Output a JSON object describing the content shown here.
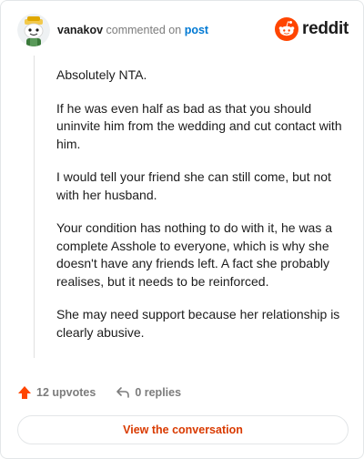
{
  "header": {
    "username": "vanakov",
    "action_text": "commented on",
    "post_link": "post",
    "logo_text": "reddit"
  },
  "comment": {
    "paragraphs": [
      "Absolutely NTA.",
      "If he was even half as bad as that you should uninvite him from the wedding and cut contact with him.",
      "I would tell your friend she can still come, but not with her husband.",
      "Your condition has nothing to do with it, he was a complete Asshole to everyone, which is why she doesn't have any friends left. A fact she probably realises, but it needs to be reinforced.",
      "She may need support because her relationship is clearly abusive."
    ]
  },
  "actions": {
    "upvotes": "12 upvotes",
    "replies": "0 replies"
  },
  "cta": {
    "label": "View the conversation"
  },
  "colors": {
    "brand": "#ff4500",
    "link": "#0079d3",
    "cta_text": "#d93a00",
    "muted": "#7c7c7c"
  },
  "icons": [
    "avatar-icon",
    "reddit-snoo-icon",
    "upvote-arrow-icon",
    "reply-arrow-icon"
  ]
}
